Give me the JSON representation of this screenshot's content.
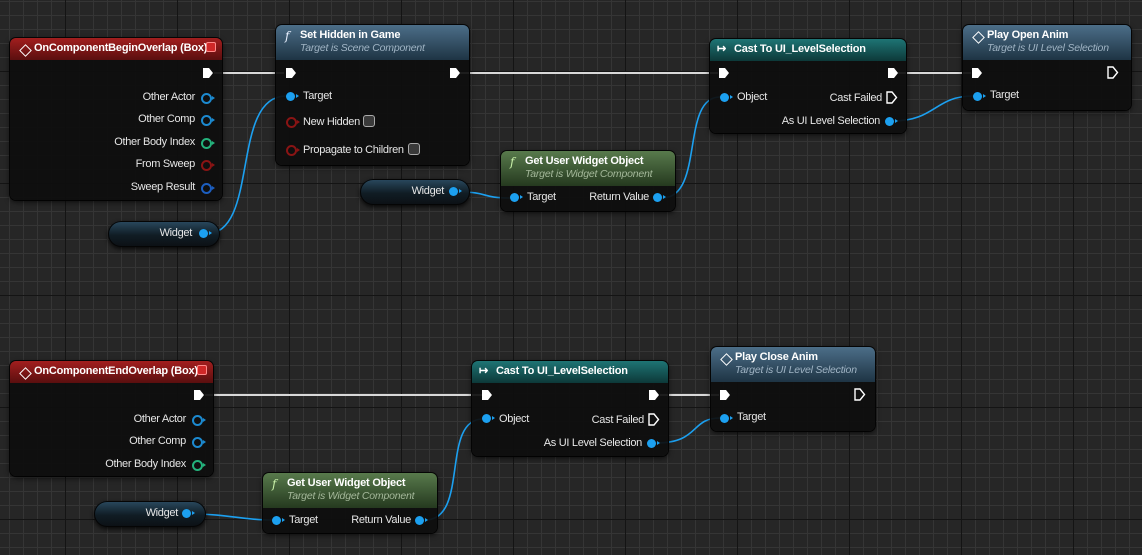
{
  "graph": {
    "begin_overlap": {
      "title": "OnComponentBeginOverlap (Box)",
      "pins": [
        "Other Actor",
        "Other Comp",
        "Other Body Index",
        "From Sweep",
        "Sweep Result"
      ]
    },
    "set_hidden": {
      "title": "Set Hidden in Game",
      "subtitle": "Target is Scene Component",
      "pins": [
        "Target",
        "New Hidden",
        "Propagate to Children"
      ],
      "new_hidden_checked": false,
      "propagate_checked": false
    },
    "cast_top": {
      "title": "Cast To UI_LevelSelection",
      "pins": {
        "object": "Object",
        "cast_failed": "Cast Failed",
        "as": "As UI Level Selection"
      }
    },
    "play_open": {
      "title": "Play Open Anim",
      "subtitle": "Target is UI Level Selection",
      "pins": [
        "Target"
      ]
    },
    "get_widget_top": {
      "title": "Get User Widget Object",
      "subtitle": "Target is Widget Component",
      "pins": {
        "target": "Target",
        "return": "Return Value"
      }
    },
    "var_widget_1": {
      "label": "Widget"
    },
    "var_widget_2": {
      "label": "Widget"
    },
    "end_overlap": {
      "title": "OnComponentEndOverlap (Box)",
      "pins": [
        "Other Actor",
        "Other Comp",
        "Other Body Index"
      ]
    },
    "cast_bottom": {
      "title": "Cast To UI_LevelSelection",
      "pins": {
        "object": "Object",
        "cast_failed": "Cast Failed",
        "as": "As UI Level Selection"
      }
    },
    "play_close": {
      "title": "Play Close Anim",
      "subtitle": "Target is UI Level Selection",
      "pins": [
        "Target"
      ]
    },
    "get_widget_bottom": {
      "title": "Get User Widget Object",
      "subtitle": "Target is Widget Component",
      "pins": {
        "target": "Target",
        "return": "Return Value"
      }
    },
    "var_widget_3": {
      "label": "Widget"
    }
  },
  "colors": {
    "exec_wire": "#d8d8d8",
    "object_wire": "#1ca0f0",
    "event_header": "#a21e1e",
    "function_header": "#4c6e88",
    "pure_header": "#587a4c",
    "cast_header": "#1e7474"
  }
}
